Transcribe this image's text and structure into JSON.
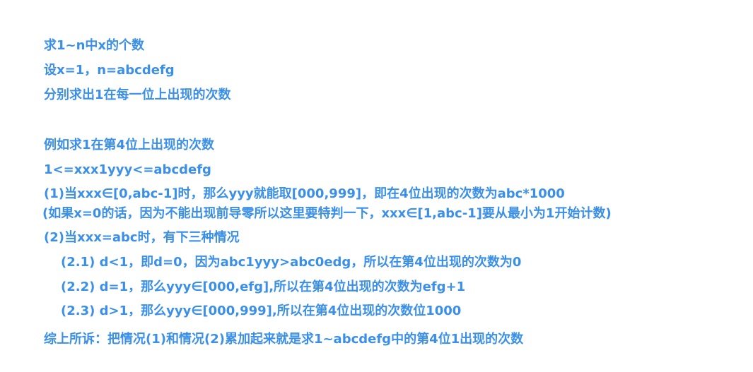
{
  "colors": {
    "text": "#3a8fe8",
    "background": "#ffffff"
  },
  "lines": [
    "求1~n中x的个数",
    "设x=1，n=abcdefg",
    "分别求出1在每一位上出现的次数",
    "例如求1在第4位上出现的次数",
    "1<=xxx1yyy<=abcdefg",
    "(1)当xxx∈[0,abc-1]时，那么yyy就能取[000,999]，即在4位出现的次数为abc*1000",
    "(如果x=0的话，因为不能出现前导零所以这里要特判一下，xxx∈[1,abc-1]要从最小为1开始计数)",
    "(2)当xxx=abc时，有下三种情况",
    "(2.1) d<1，即d=0，因为abc1yyy>abc0edg，所以在第4位出现的次数为0",
    "(2.2) d=1，那么yyy∈[000,efg],所以在第4位出现的次数为efg+1",
    "(2.3) d>1，那么yyy∈[000,999],所以在第4位出现的次数位1000",
    "综上所诉：把情况(1)和情况(2)累加起来就是求1~abcdefg中的第4位1出现的次数"
  ]
}
